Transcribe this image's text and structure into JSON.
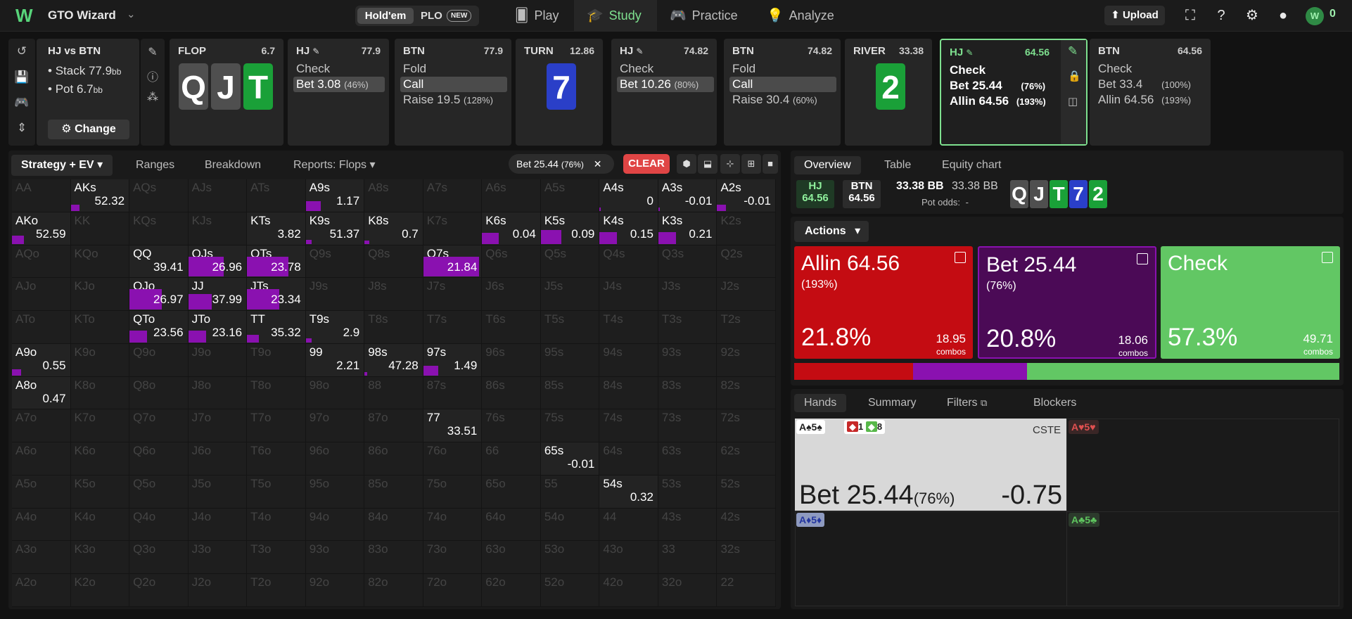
{
  "app": {
    "brand": "GTO Wizard"
  },
  "game_toggle": {
    "holdem": "Hold'em",
    "plo": "PLO",
    "plo_badge": "NEW"
  },
  "nav": [
    {
      "label": "Play",
      "icon": "cards-icon"
    },
    {
      "label": "Study",
      "icon": "graduation-cap-icon"
    },
    {
      "label": "Practice",
      "icon": "gamepad-icon"
    },
    {
      "label": "Analyze",
      "icon": "bulb-icon"
    }
  ],
  "top_right": {
    "upload": "Upload",
    "coins": "0"
  },
  "spot": {
    "title": "HJ vs BTN",
    "stack_label": "Stack",
    "stack_value": "77.9",
    "pot_label": "Pot",
    "pot_value": "6.7",
    "unit": "bb",
    "change": "Change"
  },
  "stages": {
    "flop": {
      "name": "FLOP",
      "value": "6.7",
      "cards": [
        "Q",
        "J",
        "T"
      ]
    },
    "hj1": {
      "name": "HJ",
      "value": "77.9",
      "options": [
        {
          "label": "Check",
          "pct": ""
        },
        {
          "label": "Bet 3.08",
          "pct": "(46%)"
        }
      ]
    },
    "btn1": {
      "name": "BTN",
      "value": "77.9",
      "options": [
        {
          "label": "Fold",
          "pct": ""
        },
        {
          "label": "Call",
          "pct": ""
        },
        {
          "label": "Raise 19.5",
          "pct": "(128%)"
        }
      ]
    },
    "turn": {
      "name": "TURN",
      "value": "12.86",
      "card": "7"
    },
    "hj2": {
      "name": "HJ",
      "value": "74.82",
      "options": [
        {
          "label": "Check",
          "pct": ""
        },
        {
          "label": "Bet 10.26",
          "pct": "(80%)"
        }
      ]
    },
    "btn2": {
      "name": "BTN",
      "value": "74.82",
      "options": [
        {
          "label": "Fold",
          "pct": ""
        },
        {
          "label": "Call",
          "pct": ""
        },
        {
          "label": "Raise 30.4",
          "pct": "(60%)"
        }
      ]
    },
    "river": {
      "name": "RIVER",
      "value": "33.38",
      "card": "2"
    },
    "hj3": {
      "name": "HJ",
      "value": "64.56",
      "options": [
        {
          "label": "Check",
          "pct": ""
        },
        {
          "label": "Bet 25.44",
          "pct": "(76%)"
        },
        {
          "label": "Allin 64.56",
          "pct": "(193%)"
        }
      ]
    },
    "btn3": {
      "name": "BTN",
      "value": "64.56",
      "options": [
        {
          "label": "Check",
          "pct": ""
        },
        {
          "label": "Bet 33.4",
          "pct": "(100%)"
        },
        {
          "label": "Allin 64.56",
          "pct": "(193%)"
        }
      ]
    }
  },
  "controls": {
    "strategy": "Strategy + EV",
    "ranges": "Ranges",
    "breakdown": "Breakdown",
    "reports": "Reports: Flops",
    "filter_pill": "Bet 25.44",
    "filter_pill_pct": "(76%)",
    "clear": "CLEAR"
  },
  "matrix": {
    "ranks": [
      "A",
      "K",
      "Q",
      "J",
      "T",
      "9",
      "8",
      "7",
      "6",
      "5",
      "4",
      "3",
      "2"
    ],
    "values": {
      "AKs": [
        "52.32",
        0.15
      ],
      "A9s": [
        "1.17",
        0.25
      ],
      "A4s": [
        "0",
        0.02
      ],
      "A3s": [
        "-0.01",
        0.02
      ],
      "A2s": [
        "-0.01",
        0.15
      ],
      "AKo": [
        "52.59",
        0.2
      ],
      "KTs": [
        "3.82",
        0
      ],
      "K9s": [
        "51.37",
        0.1
      ],
      "K8s": [
        "0.7",
        0.08
      ],
      "K6s": [
        "0.04",
        0.28
      ],
      "K5s": [
        "0.09",
        0.35
      ],
      "K4s": [
        "0.15",
        0.3
      ],
      "K3s": [
        "0.21",
        0.3
      ],
      "QQ": [
        "39.41",
        0
      ],
      "QJs": [
        "26.96",
        0.6
      ],
      "QTs": [
        "23.78",
        0.7
      ],
      "Q7s": [
        "21.84",
        0.95
      ],
      "QJo": [
        "26.97",
        0.55
      ],
      "JJ": [
        "37.99",
        0.4
      ],
      "JTs": [
        "23.34",
        0.55
      ],
      "QTo": [
        "23.56",
        0.3
      ],
      "JTo": [
        "23.16",
        0.3
      ],
      "TT": [
        "35.32",
        0.2
      ],
      "T9s": [
        "2.9",
        0.1
      ],
      "A9o": [
        "0.55",
        0.15
      ],
      "99": [
        "2.21",
        0
      ],
      "98s": [
        "47.28",
        0.05
      ],
      "97s": [
        "1.49",
        0.25
      ],
      "A8o": [
        "0.47",
        0
      ],
      "77": [
        "33.51",
        0
      ],
      "65s": [
        "-0.01",
        0
      ],
      "54s": [
        "0.32",
        0
      ]
    }
  },
  "right_tabs": {
    "overview": "Overview",
    "table": "Table",
    "equity": "Equity chart"
  },
  "overview": {
    "hj_label": "HJ",
    "hj_value": "64.56",
    "btn_label": "BTN",
    "btn_value": "64.56",
    "pot_a": "33.38 BB",
    "pot_b": "33.38 BB",
    "pot_odds_label": "Pot odds:",
    "pot_odds_value": "-",
    "board": [
      "Q",
      "J",
      "T",
      "7",
      "2"
    ]
  },
  "actions": {
    "header": "Actions",
    "items": [
      {
        "name": "Allin 64.56",
        "pct_size": "(193%)",
        "freq": "21.8%",
        "combos": "18.95",
        "combos_label": "combos",
        "color": "#c40c12"
      },
      {
        "name": "Bet 25.44",
        "pct_size": "(76%)",
        "freq": "20.8%",
        "combos": "18.06",
        "combos_label": "combos",
        "color": "#4b0a56"
      },
      {
        "name": "Check",
        "pct_size": "",
        "freq": "57.3%",
        "combos": "49.71",
        "combos_label": "combos",
        "color": "#62c764"
      }
    ],
    "mix": [
      0.218,
      0.208,
      0.573
    ]
  },
  "bottom_tabs": {
    "hands": "Hands",
    "summary": "Summary",
    "filters": "Filters",
    "blockers": "Blockers"
  },
  "hands": {
    "main": {
      "tag": "A♠5♠",
      "badge_a": "1",
      "badge_b": "8",
      "code": "CSTE",
      "action": "Bet 25.44",
      "pct": "(76%)",
      "ev": "-0.75"
    },
    "tags": [
      "A♥5♥",
      "A♦5♦",
      "A♣5♣"
    ]
  }
}
